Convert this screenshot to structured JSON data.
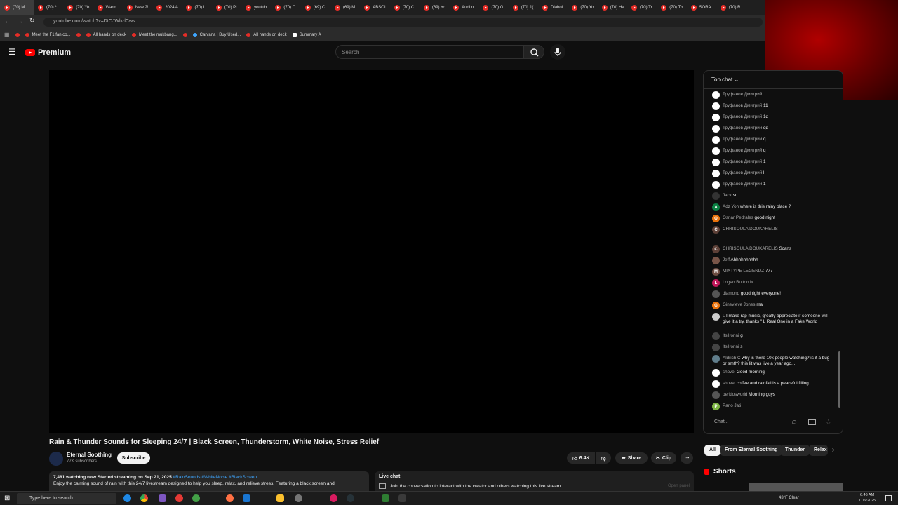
{
  "browser": {
    "tabs": [
      "(70) M",
      "(70) *",
      "(70) Yo",
      "Warm",
      "New 2!",
      "2024 A",
      "(70) I",
      "(70) Pi",
      "youtub",
      "(70) C",
      "(69) C",
      "(69) M",
      "ABSOL",
      "(70) C",
      "(69) Yo",
      "Audi n",
      "(70) G",
      "(70) 1(",
      "Diabol",
      "(70) Yo",
      "(70) He",
      "(70) Tr",
      "(70) Th",
      "SORA",
      "(70) R"
    ],
    "url": "youtube.com/watch?v=DtCJWbzlCws",
    "bookmarks": [
      "Meet the F1 fan co...",
      "All hands on deck",
      "Meet the mukbang...",
      "Carvana | Buy Used...",
      "All hands on deck",
      "Summary A"
    ]
  },
  "header": {
    "logo_text": "Premium",
    "search_placeholder": "Search"
  },
  "video": {
    "title": "Rain & Thunder Sounds for Sleeping 24/7 | Black Screen, Thunderstorm, White Noise, Stress Relief",
    "channel": "Eternal Soothing",
    "subscribers": "77K subscribers",
    "subscribe_label": "Subscribe",
    "likes": "6.4K",
    "share_label": "Share",
    "clip_label": "Clip",
    "stats": "7,481 watching now  Started streaming on Sep 21, 2025",
    "tags": "#RainSounds #WhiteNoise #BlackScreen",
    "description": "Enjoy the calming sound of rain with this 24/7 livestream designed to help you sleep, relax, and relieve stress. Featuring a black screen and"
  },
  "live_chat_box": {
    "title": "Live chat",
    "text": "Join the conversation to interact with the creator and others watching this live stream.",
    "button": "Open panel"
  },
  "chat": {
    "header": "Top chat",
    "input_placeholder": "Chat...",
    "messages": [
      {
        "author": "Труфанов Дмитрий",
        "text": "",
        "color": "#ffffff"
      },
      {
        "author": "Труфанов Дмитрий",
        "text": "11",
        "color": "#ffffff"
      },
      {
        "author": "Труфанов Дмитрий",
        "text": "1q",
        "color": "#ffffff"
      },
      {
        "author": "Труфанов Дмитрий",
        "text": "qq",
        "color": "#ffffff"
      },
      {
        "author": "Труфанов Дмитрий",
        "text": "q",
        "color": "#ffffff"
      },
      {
        "author": "Труфанов Дмитрий",
        "text": "q",
        "color": "#ffffff"
      },
      {
        "author": "Труфанов Дмитрий",
        "text": "1",
        "color": "#ffffff"
      },
      {
        "author": "Труфанов Дмитрий",
        "text": "l",
        "color": "#ffffff"
      },
      {
        "author": "Труфанов Дмитрий",
        "text": "1",
        "color": "#ffffff"
      },
      {
        "author": "Jack",
        "text": "su",
        "color": "#333333"
      },
      {
        "author": "Adz Yoh",
        "text": "where is this rainy place ?",
        "color": "#0b8043",
        "initial": "A"
      },
      {
        "author": "Osnar Pedrales",
        "text": "good night",
        "color": "#e8710a",
        "initial": "O"
      },
      {
        "author": "CHRISOULA DOUKARELIS",
        "text": "",
        "color": "#5d4037",
        "initial": "C"
      },
      {
        "author": "CHRISOULA DOUKARELIS",
        "text": "Scans",
        "color": "#5d4037",
        "initial": "C"
      },
      {
        "author": "Jeff",
        "text": "Ahhhhhhhhhh",
        "color": "#795548"
      },
      {
        "author": "MIXTYPE LEGENDZ",
        "text": "777",
        "color": "#6d4c41",
        "initial": "M"
      },
      {
        "author": "Logan Button",
        "text": "hi",
        "color": "#c2185b",
        "initial": "L"
      },
      {
        "author": "diamond",
        "text": "goodnight everyone!",
        "color": "#555555"
      },
      {
        "author": "Ginevieve Jones",
        "text": "ma",
        "color": "#e8710a",
        "initial": "G"
      },
      {
        "author": "L",
        "text": "I make rap music, greatly appreciate if someone will give it a try, thanks \" L Real One in a Fake World",
        "color": "#cccccc"
      },
      {
        "author": "Itsllronni",
        "text": "g",
        "color": "#444444"
      },
      {
        "author": "Itsllronni",
        "text": "s",
        "color": "#444444"
      },
      {
        "author": "Aldrich C",
        "text": "why is there 10k people watching? is it a bug or smth? this lit was live a year ago...",
        "color": "#607d8b"
      },
      {
        "author": "shovel",
        "text": "Good morning",
        "color": "#ffffff"
      },
      {
        "author": "shovel",
        "text": "coffee and rainfall is a peaceful filling",
        "color": "#ffffff"
      },
      {
        "author": "perkiosworld",
        "text": "Morning guys",
        "color": "#555555"
      },
      {
        "author": "Parjo Jati",
        "text": "",
        "color": "#7cb342",
        "initial": "P"
      }
    ]
  },
  "chips": [
    "All",
    "From Eternal Soothing",
    "Thunder",
    "Relax"
  ],
  "shorts_title": "Shorts",
  "taskbar": {
    "search_placeholder": "Type here to search",
    "weather": "43°F  Clear",
    "time": "6:46 AM",
    "date": "11/6/2025"
  }
}
